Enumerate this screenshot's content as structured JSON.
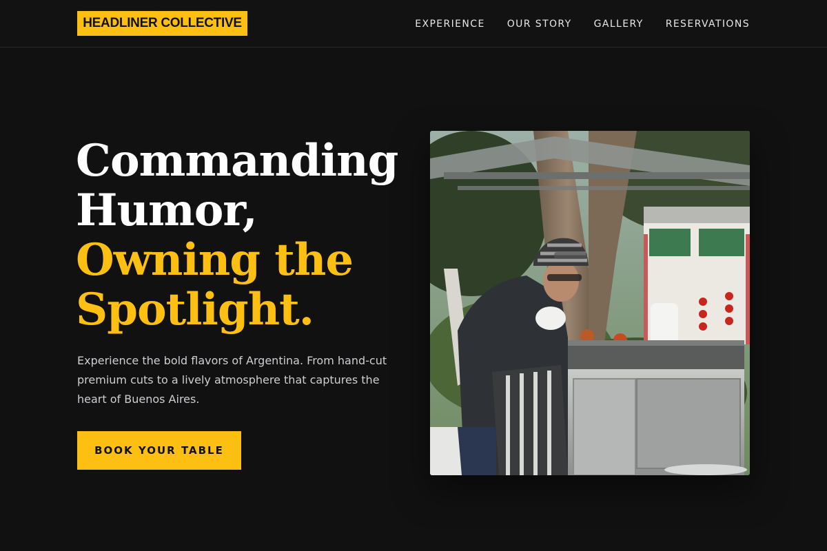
{
  "brand": {
    "name": "HEADLINER COLLECTIVE",
    "accent_color": "#fdbf12",
    "background_color": "#111112"
  },
  "nav": {
    "items": [
      {
        "label": "EXPERIENCE"
      },
      {
        "label": "OUR STORY"
      },
      {
        "label": "GALLERY"
      },
      {
        "label": "RESERVATIONS"
      }
    ]
  },
  "hero": {
    "title_lines": [
      "Commanding",
      "Humor,"
    ],
    "accent_lines": [
      "Owning the",
      "Spotlight."
    ],
    "description": "Experience the bold flavors of Argentina. From hand-cut premium cuts to a lively atmosphere that captures the heart of Buenos Aires.",
    "cta_label": "BOOK YOUR TABLE",
    "photo_icon": "street-vendor-photo"
  }
}
